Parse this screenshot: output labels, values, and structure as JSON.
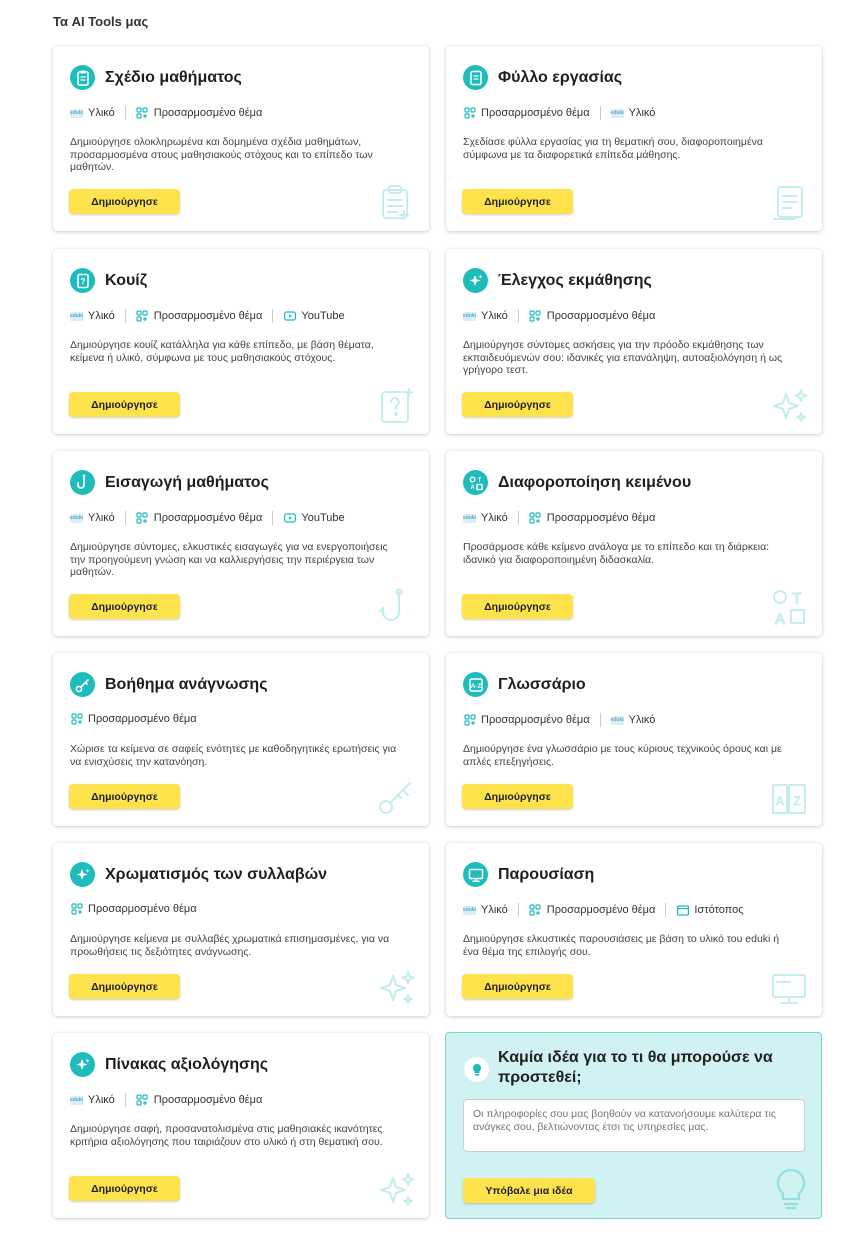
{
  "section_title": "Τα AI Tools μας",
  "colors": {
    "accent": "#1fbcbc",
    "button": "#ffe34d",
    "idea_bg": "#d1f2f2"
  },
  "tag_labels": {
    "material": "Υλικό",
    "custom": "Προσαρμοσμένο θέμα",
    "youtube": "YouTube",
    "website": "Ιστότοπος"
  },
  "create_label": "Δημιούργησε",
  "cards": [
    {
      "title": "Σχέδιο μαθήματος",
      "icon": "clipboard-icon",
      "tags": [
        "Υλικό",
        "Προσαρμοσμένο θέμα"
      ],
      "desc": "Δημιούργησε ολοκληρωμένα και δομημένα σχέδια μαθημάτων, προσαρμοσμένα στους μαθησιακούς στόχους και το επίπεδο των μαθητών."
    },
    {
      "title": "Φύλλο εργασίας",
      "icon": "worksheet-icon",
      "tags": [
        "Προσαρμοσμένο θέμα",
        "Υλικό"
      ],
      "desc": "Σχεδίασε φύλλα εργασίας για τη θεματική σου, διαφοροποιημένα σύμφωνα με τα διαφορετικά επίπεδα μάθησης."
    },
    {
      "title": "Κουίζ",
      "icon": "quiz-icon",
      "tags": [
        "Υλικό",
        "Προσαρμοσμένο θέμα",
        "YouTube"
      ],
      "desc": "Δημιούργησε κουίζ κατάλληλα για κάθε επίπεδο, με βάση θέματα, κείμενα ή υλικό, σύμφωνα με τους μαθησιακούς στόχους."
    },
    {
      "title": "Έλεγχος εκμάθησης",
      "icon": "sparkle-icon",
      "tags": [
        "Υλικό",
        "Προσαρμοσμένο θέμα"
      ],
      "desc": "Δημιούργησε σύντομες ασκήσεις για την πρόοδο εκμάθησης των εκπαιδευόμενών σου: ιδανικές για επανάληψη, αυτοαξιολόγηση ή ως γρήγορο τεστ."
    },
    {
      "title": "Εισαγωγή μαθήματος",
      "icon": "hook-icon",
      "tags": [
        "Υλικό",
        "Προσαρμοσμένο θέμα",
        "YouTube"
      ],
      "desc": "Δημιούργησε σύντομες, ελκυστικές εισαγωγές για να ενεργοποιήσεις την προηγούμενη γνώση και να καλλιεργήσεις την περιέργεια των μαθητών."
    },
    {
      "title": "Διαφοροποίηση κειμένου",
      "icon": "shapes-icon",
      "tags": [
        "Υλικό",
        "Προσαρμοσμένο θέμα"
      ],
      "desc": "Προσάρμοσε κάθε κείμενο ανάλογα με το επίπεδο και τη διάρκεια: ιδανικό για διαφοροποιημένη διδασκαλία."
    },
    {
      "title": "Βοήθημα ανάγνωσης",
      "icon": "key-icon",
      "tags": [
        "Προσαρμοσμένο θέμα"
      ],
      "desc": "Χώρισε τα κείμενα σε σαφείς ενότητες με καθοδηγητικές ερωτήσεις για να ενισχύσεις την κατανόηση."
    },
    {
      "title": "Γλωσσάριο",
      "icon": "glossary-icon",
      "tags": [
        "Προσαρμοσμένο θέμα",
        "Υλικό"
      ],
      "desc": "Δημιούργησε ένα γλωσσάριο με τους κύριους τεχνικούς όρους και με απλές επεξηγήσεις."
    },
    {
      "title": "Χρωματισμός των συλλαβών",
      "icon": "sparkle-icon",
      "tags": [
        "Προσαρμοσμένο θέμα"
      ],
      "desc": "Δημιούργησε κείμενα με συλλαβές χρωματικά επισημασμένες, για να προωθήσεις τις δεξιότητες ανάγνωσης."
    },
    {
      "title": "Παρουσίαση",
      "icon": "monitor-icon",
      "tags": [
        "Υλικό",
        "Προσαρμοσμένο θέμα",
        "Ιστότοπος"
      ],
      "desc": "Δημιούργησε ελκυστικές παρουσιάσεις με βάση το υλικό του eduki ή ένα θέμα της επιλογής σου."
    },
    {
      "title": "Πίνακας αξιολόγησης",
      "icon": "sparkle-icon",
      "tags": [
        "Υλικό",
        "Προσαρμοσμένο θέμα"
      ],
      "desc": "Δημιούργησε σαφή, προσανατολισμένα στις μαθησιακές ικανότητες κριτήρια αξιολόγησης που ταιριάζουν στο υλικό ή στη θεματική σου."
    }
  ],
  "idea": {
    "title": "Καμία ιδέα για το τι θα μπορούσε να προστεθεί;",
    "placeholder": "Οι πληροφορίες σου μας βοηθούν να κατανοήσουμε καλύτερα τις ανάγκες σου, βελτιώνοντας έτσι τις υπηρεσίες μας.",
    "button": "Υπόβαλε μια ιδέα",
    "icon": "lightbulb-icon"
  }
}
